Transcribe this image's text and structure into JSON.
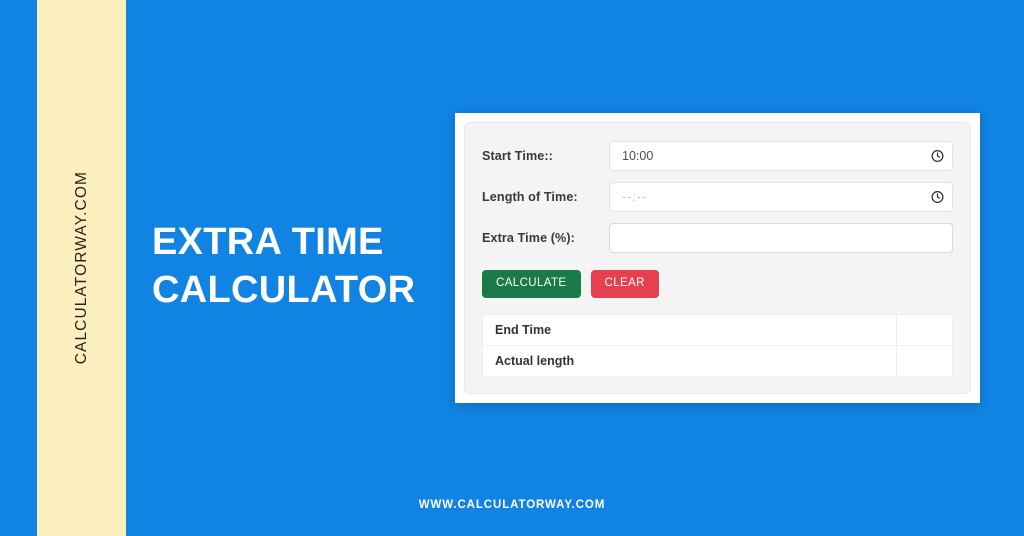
{
  "theme": {
    "background_color": "#1183e2",
    "accent_strip_color": "#fcefbe",
    "calculate_button_color": "#1a7a45",
    "clear_button_color": "#e4404f"
  },
  "branding": {
    "vertical_text": "CALCULATORWAY.COM",
    "footer_url": "WWW.CALCULATORWAY.COM"
  },
  "hero": {
    "title_line_1": "EXTRA TIME",
    "title_line_2": "CALCULATOR"
  },
  "calculator": {
    "fields": [
      {
        "label": "Start Time::",
        "value": "10:00",
        "placeholder": "--:--",
        "has_clock_icon": true,
        "is_placeholder": false,
        "icon": "clock-icon"
      },
      {
        "label": "Length of Time:",
        "value": "--:--",
        "placeholder": "--:--",
        "has_clock_icon": true,
        "is_placeholder": true,
        "icon": "clock-icon"
      },
      {
        "label": "Extra Time (%):",
        "value": "",
        "placeholder": "",
        "has_clock_icon": false,
        "is_placeholder": false,
        "icon": ""
      }
    ],
    "buttons": {
      "calculate_label": "CALCULATE",
      "clear_label": "CLEAR"
    },
    "results": {
      "rows": [
        {
          "label": "End Time",
          "value": ""
        },
        {
          "label": "Actual length",
          "value": ""
        }
      ]
    }
  }
}
